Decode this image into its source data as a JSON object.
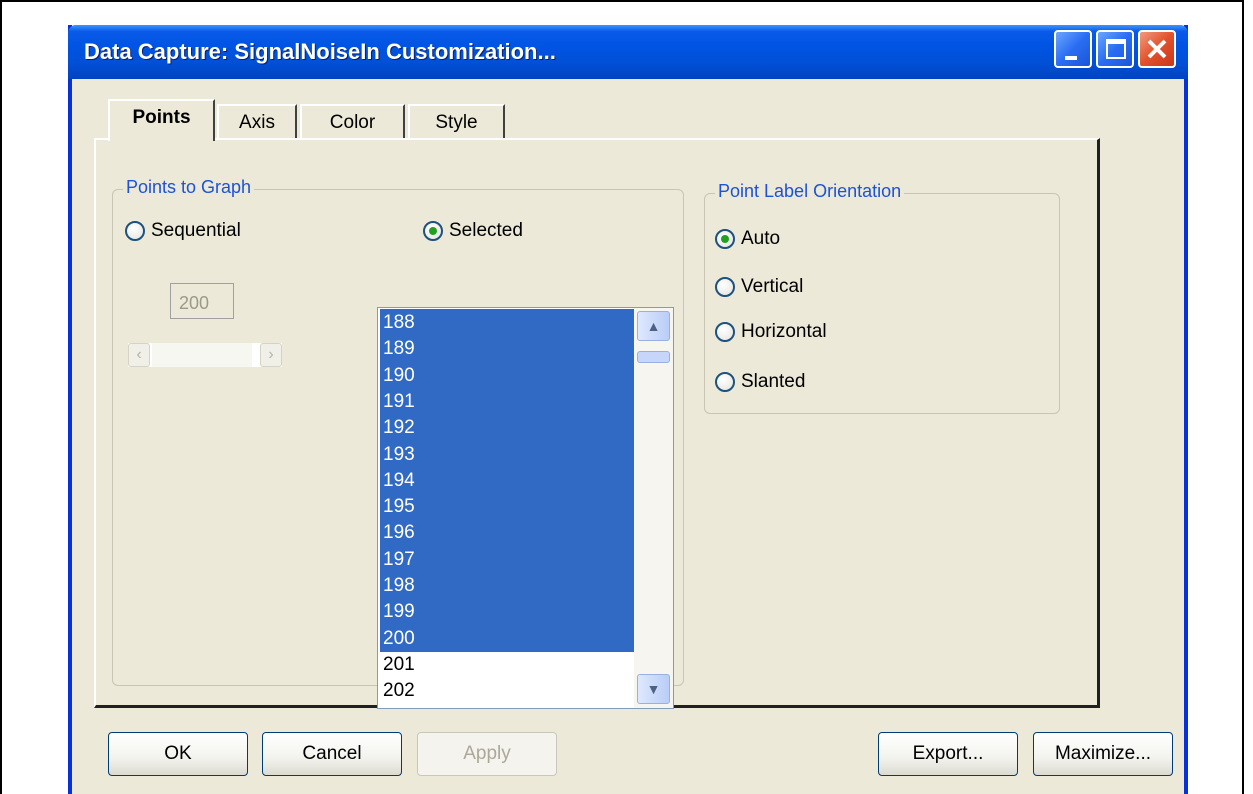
{
  "window": {
    "title": "Data Capture: SignalNoiseIn Customization..."
  },
  "tabs": [
    {
      "label": "Points",
      "active": true
    },
    {
      "label": "Axis",
      "active": false
    },
    {
      "label": "Color",
      "active": false
    },
    {
      "label": "Style",
      "active": false
    }
  ],
  "points_group": {
    "title": "Points to Graph",
    "sequential_label": "Sequential",
    "selected_label": "Selected",
    "selected_option": "Selected",
    "count_value": "200",
    "list_items": [
      {
        "value": "188",
        "selected": true
      },
      {
        "value": "189",
        "selected": true
      },
      {
        "value": "190",
        "selected": true
      },
      {
        "value": "191",
        "selected": true
      },
      {
        "value": "192",
        "selected": true
      },
      {
        "value": "193",
        "selected": true
      },
      {
        "value": "194",
        "selected": true
      },
      {
        "value": "195",
        "selected": true
      },
      {
        "value": "196",
        "selected": true
      },
      {
        "value": "197",
        "selected": true
      },
      {
        "value": "198",
        "selected": true
      },
      {
        "value": "199",
        "selected": true
      },
      {
        "value": "200",
        "selected": true
      },
      {
        "value": "201",
        "selected": false
      },
      {
        "value": "202",
        "selected": false
      }
    ]
  },
  "orientation_group": {
    "title": "Point Label Orientation",
    "options": [
      "Auto",
      "Vertical",
      "Horizontal",
      "Slanted"
    ],
    "selected": "Auto"
  },
  "buttons": {
    "ok": "OK",
    "cancel": "Cancel",
    "apply": "Apply",
    "export": "Export...",
    "maximize": "Maximize..."
  },
  "colors": {
    "title_bar": "#0054e3",
    "selection": "#316ac5",
    "group_label": "#1b52d6",
    "dialog_background": "#ece9d8"
  }
}
